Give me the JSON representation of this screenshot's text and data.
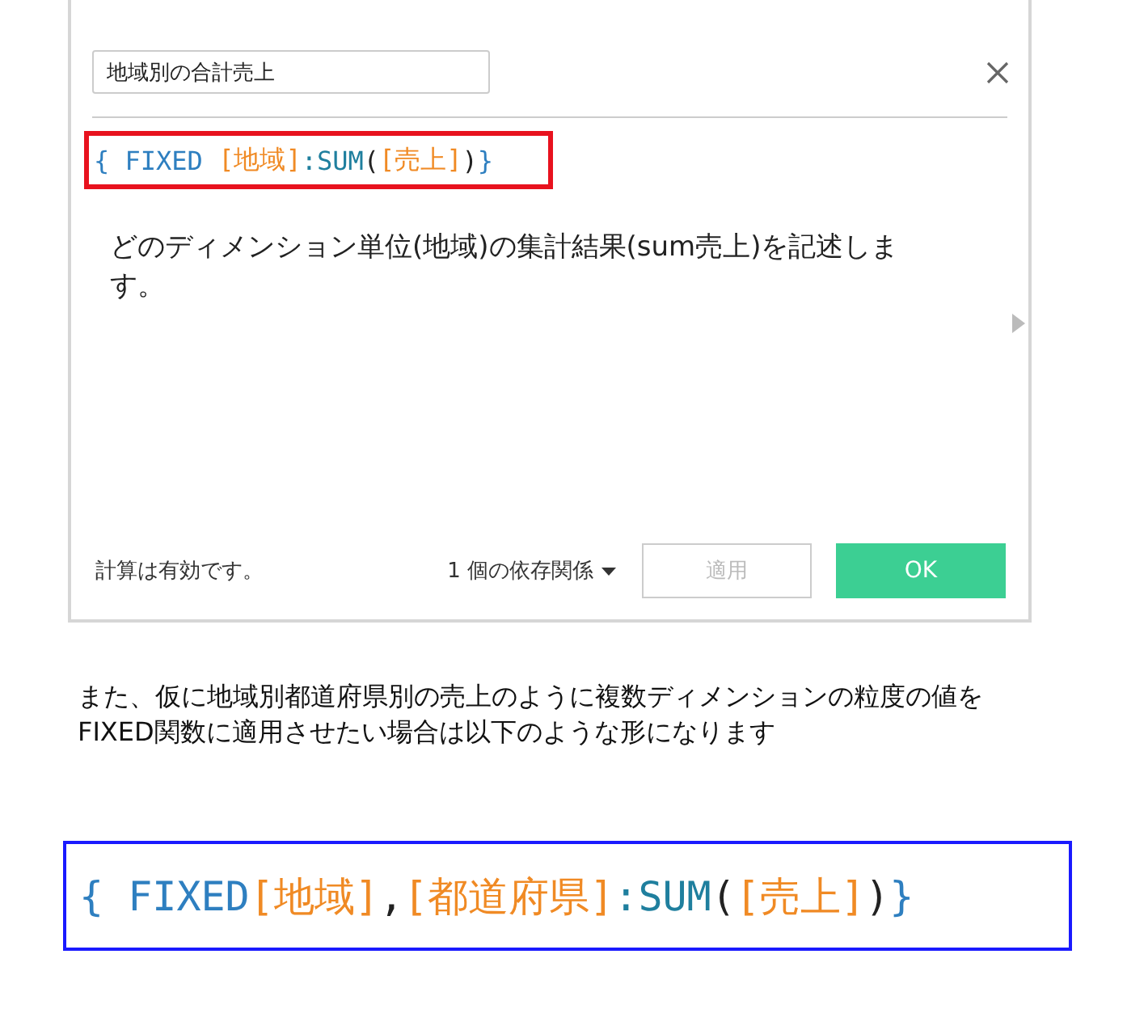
{
  "dialog": {
    "name_field": {
      "value": "地域別の合計売上"
    },
    "formula": [
      {
        "kind": "keyword",
        "text": "{ FIXED "
      },
      {
        "kind": "field",
        "text": "[地域]"
      },
      {
        "kind": "function",
        "text": ":SUM"
      },
      {
        "kind": "punct",
        "text": "("
      },
      {
        "kind": "field",
        "text": "[売上]"
      },
      {
        "kind": "punct",
        "text": ")"
      },
      {
        "kind": "keyword",
        "text": "}"
      }
    ],
    "description": "どのディメンション単位(地域)の集計結果(sum売上)を記述します。",
    "status": "計算は有効です。",
    "dependencies": "1 個の依存関係",
    "apply_button": {
      "label": "適用",
      "disabled": true
    },
    "ok_button": {
      "label": "OK"
    }
  },
  "paragraph": "また、仮に地域別都道府県別の売上のように複数ディメンションの粒度の値をFIXED関数に適用させたい場合は以下のような形になります",
  "example_formula": [
    {
      "kind": "keyword",
      "text": "{ FIXED"
    },
    {
      "kind": "field",
      "text": "[地域]"
    },
    {
      "kind": "punct",
      "text": ","
    },
    {
      "kind": "field",
      "text": "[都道府県]"
    },
    {
      "kind": "function",
      "text": ":SUM"
    },
    {
      "kind": "punct",
      "text": "("
    },
    {
      "kind": "field",
      "text": "[売上]"
    },
    {
      "kind": "punct",
      "text": ")"
    },
    {
      "kind": "keyword",
      "text": "}"
    }
  ]
}
